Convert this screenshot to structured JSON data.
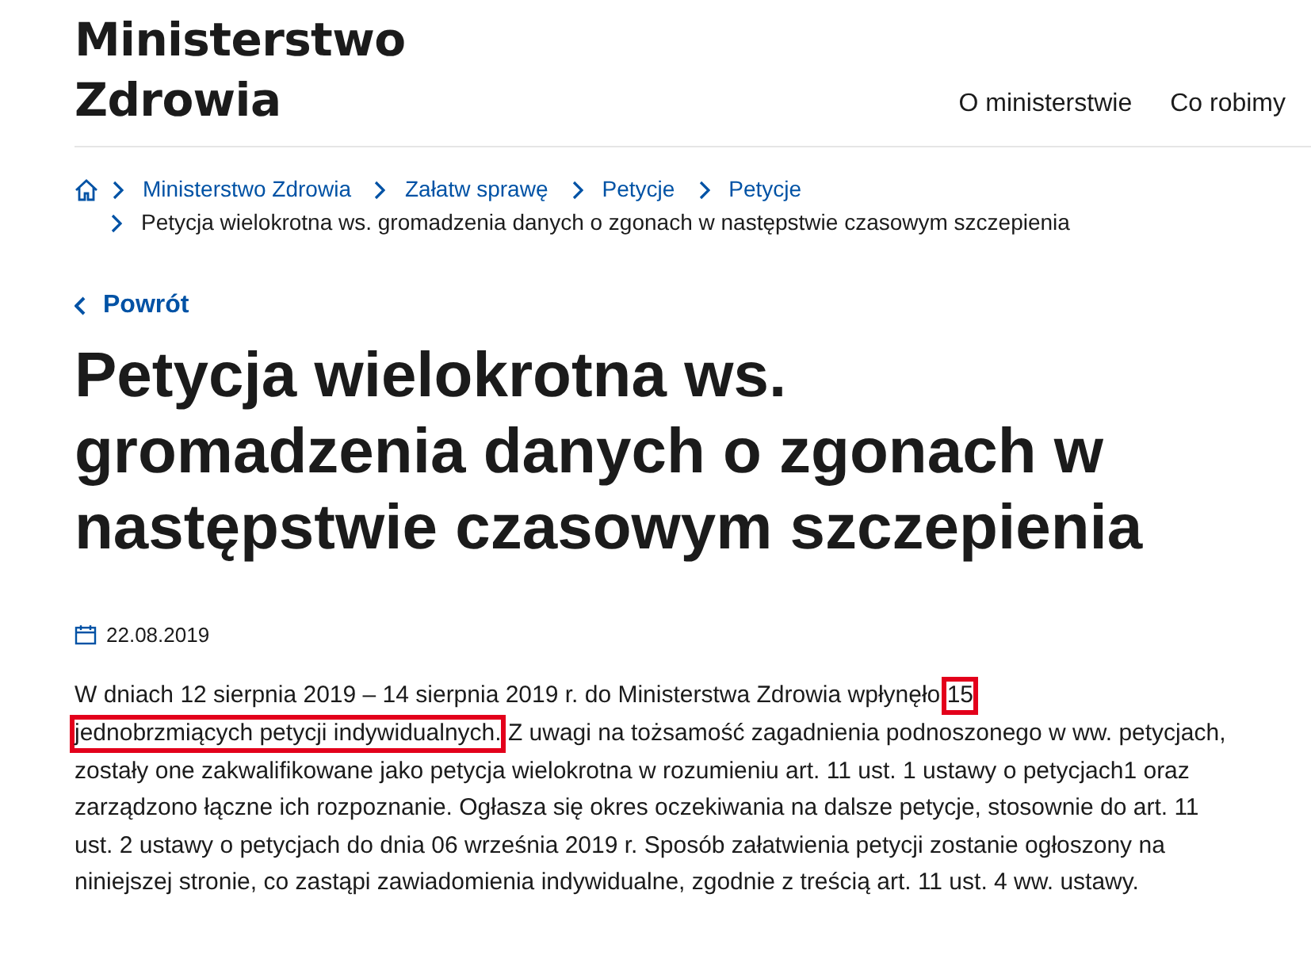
{
  "header": {
    "logo_lines": [
      "Ministerstwo",
      "Zdrowia"
    ],
    "nav": [
      "O ministerstwie",
      "Co robimy"
    ]
  },
  "breadcrumbs": [
    {
      "label": "Ministerstwo Zdrowia",
      "current": false
    },
    {
      "label": "Załatw sprawę",
      "current": false
    },
    {
      "label": "Petycje",
      "current": false
    },
    {
      "label": "Petycje",
      "current": false
    },
    {
      "label": "Petycja wielokrotna ws. gromadzenia danych o zgonach w następstwie czasowym szczepienia",
      "current": true
    }
  ],
  "back_link": "Powrót",
  "title": "Petycja wielokrotna ws. gromadzenia danych o zgonach w następstwie czasowym szczepienia",
  "date": "22.08.2019",
  "paragraph": [
    {
      "text": "W dniach 12 sierpnia 2019 – 14 sierpnia 2019 r. do Ministerstwa Zdrowia wpłynęło ",
      "highlighted": false
    },
    {
      "text": "15",
      "highlighted": true
    },
    {
      "text": "jednobrzmiących petycji indywidualnych.",
      "highlighted": true
    },
    {
      "text": " Z uwagi na tożsamość zagadnienia podnoszonego w ww. petycjach, zostały one zakwalifikowane jako petycja wielokrotna w rozumieniu art. 11 ust. 1 ustawy o petycjach1 oraz zarządzono łączne ich rozpoznanie. Ogłasza się okres oczekiwania na dalsze petycje, stosownie do art. 11 ust. 2 ustawy o petycjach do dnia 06 września 2019 r. Sposób załatwienia petycji zostanie ogłoszony na niniejszej stronie, co zastąpi zawiadomienia indywidualne, zgodnie z treścią art. 11 ust. 4 ww. ustawy.",
      "highlighted": false
    }
  ]
}
